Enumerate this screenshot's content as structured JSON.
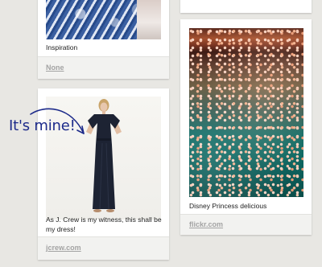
{
  "pins": [
    {
      "caption": "Inspiration",
      "source": "None"
    },
    {
      "caption": "As J. Crew is my witness, this shall be my dress!",
      "source": "jcrew.com"
    },
    {
      "caption": "Disney Princess delicious",
      "source": "flickr.com"
    }
  ],
  "annotation": {
    "text": "It's mine!"
  },
  "colors": {
    "background": "#e8e7e3",
    "annotation": "#1c2a8a",
    "source_link": "#a3a3a3"
  },
  "icons": [
    "hand-drawn-arrow-icon"
  ]
}
